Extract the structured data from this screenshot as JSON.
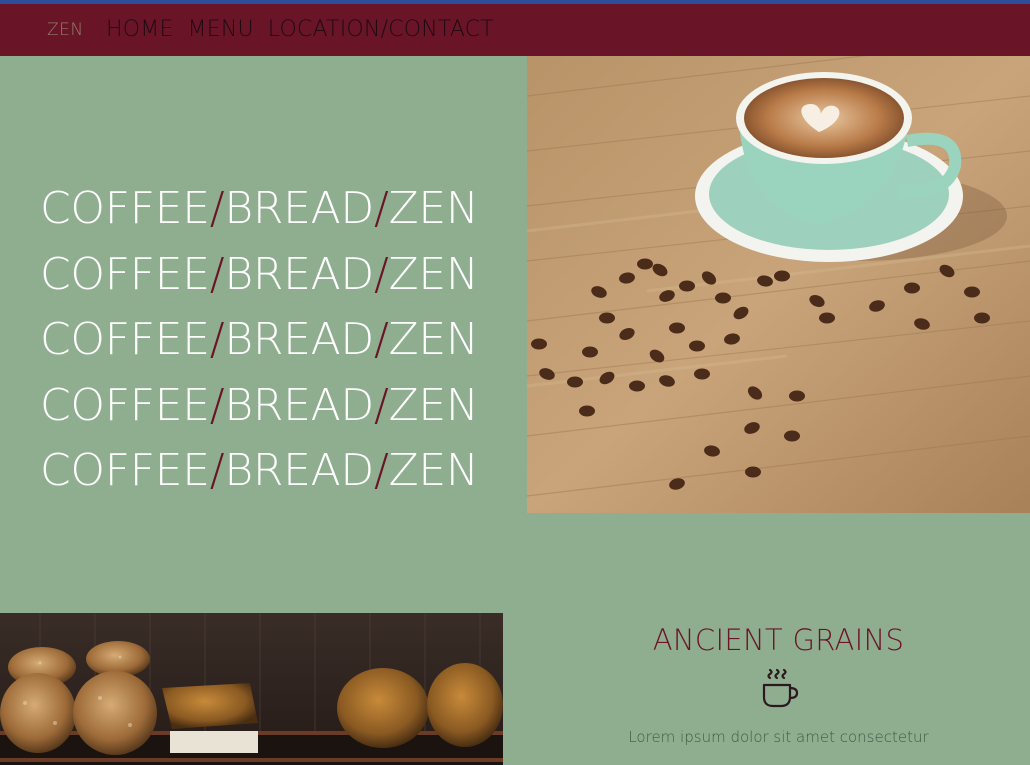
{
  "nav": {
    "brand": "ZEN",
    "links": [
      "HOME",
      "MENU",
      "LOCATION/CONTACT"
    ]
  },
  "hero": {
    "lines": [
      {
        "a": "COFFEE",
        "sep1": "/",
        "b": "BREAD",
        "sep2": "/",
        "c": "ZEN"
      },
      {
        "a": "COFFEE",
        "sep1": "/",
        "b": "BREAD",
        "sep2": "/",
        "c": "ZEN"
      },
      {
        "a": "COFFEE",
        "sep1": "/",
        "b": "BREAD",
        "sep2": "/",
        "c": "ZEN"
      },
      {
        "a": "COFFEE",
        "sep1": "/",
        "b": "BREAD",
        "sep2": "/",
        "c": "ZEN"
      },
      {
        "a": "COFFEE",
        "sep1": "/",
        "b": "BREAD",
        "sep2": "/",
        "c": "ZEN"
      }
    ]
  },
  "feature": {
    "title": "ANCIENT GRAINS",
    "icon": "coffee-cup-icon",
    "text": "Lorem ipsum dolor sit amet consectetur"
  },
  "colors": {
    "background": "#8fae90",
    "navbar": "#6a1428",
    "accent": "#6a1428",
    "topline": "#2e4e9a"
  }
}
